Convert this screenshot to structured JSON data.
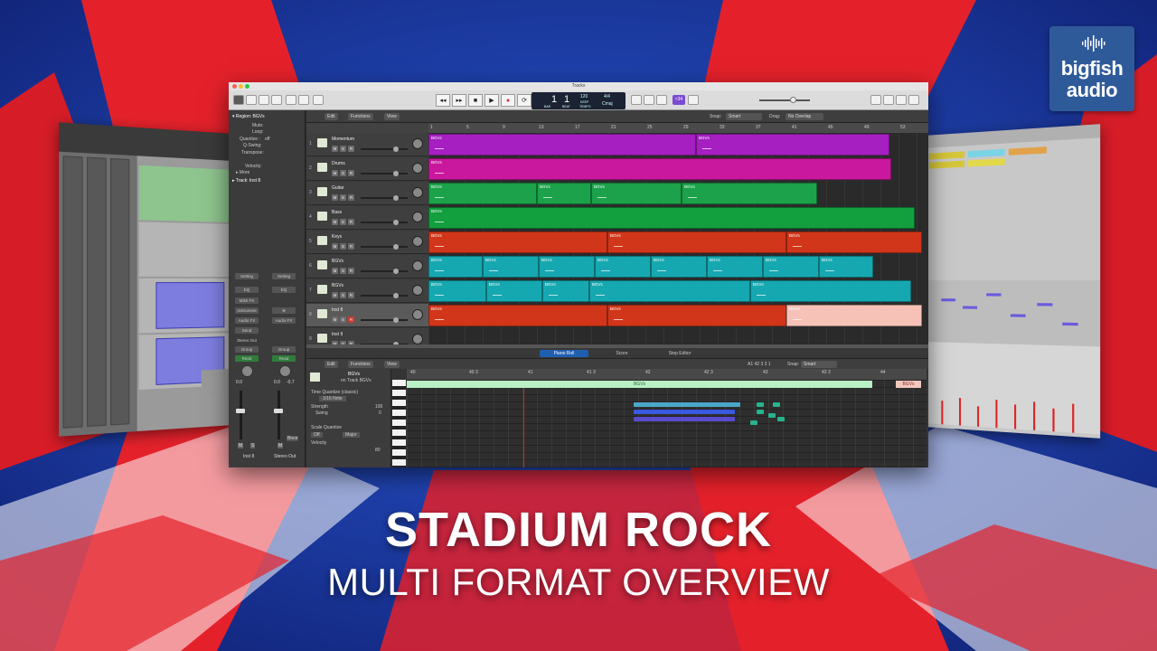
{
  "brand": {
    "line1": "bigfish",
    "line2": "audio"
  },
  "headline": {
    "title": "STADIUM ROCK",
    "subtitle": "MULTI FORMAT OVERVIEW"
  },
  "colors": {
    "bg_red": "#e4212b",
    "bg_blue": "#1e3aa8",
    "logo": "#2f5a9a",
    "accent_purple": "#7a4bd1"
  },
  "logic": {
    "window_title": "Tracks",
    "lcd": {
      "bar": "1",
      "beat": "1",
      "bar_label": "BAR",
      "beat_label": "BEAT",
      "tempo": "120",
      "tempo_label": "KEEP",
      "tempo_sub": "TEMPO",
      "sig": "4/4",
      "key": "Cmaj"
    },
    "cpu_badge": "≈34",
    "inspector": {
      "region_label": "▾ Region: BGVs",
      "mute": "Mute:",
      "loop": "Loop:",
      "quantize": "Quantize :",
      "quantize_val": "off",
      "qswing": "Q-Swing:",
      "transpose": "Transpose:",
      "velocity": "Velocity:",
      "more": "▸ More",
      "track_label": "▸ Track: Inst 8",
      "setting": "Setting",
      "eq": "EQ",
      "midi_fx": "MIDI FX",
      "instrument": "Instrument",
      "audio_fx": "Audio FX",
      "send": "Send",
      "stereo_out": "Stereo Out",
      "group": "Group",
      "read": "Read",
      "vol_left": "0.0",
      "vol_right": "0.0",
      "vol_right2": "-0.7",
      "ch_left": "Inst 8",
      "ch_right": "Stereo Out",
      "bnce": "Bnce",
      "m": "M",
      "s": "S"
    },
    "toolbar": {
      "edit": "Edit",
      "functions": "Functions",
      "view": "View",
      "snap_label": "Snap:",
      "snap": "Smart",
      "drag_label": "Drag:",
      "drag": "No Overlap"
    },
    "ruler": [
      "1",
      "5",
      "9",
      "13",
      "17",
      "21",
      "25",
      "29",
      "33",
      "37",
      "41",
      "45",
      "49",
      "53"
    ],
    "tracks": [
      {
        "num": "1",
        "name": "Momentum",
        "color": "#a51fc1"
      },
      {
        "num": "2",
        "name": "Drums",
        "color": "#c9179e"
      },
      {
        "num": "3",
        "name": "Guitar",
        "color": "#1ba24a"
      },
      {
        "num": "4",
        "name": "Bass",
        "color": "#129f3e"
      },
      {
        "num": "5",
        "name": "Keys",
        "color": "#d1361a"
      },
      {
        "num": "6",
        "name": "BGVs",
        "color": "#16a8b0"
      },
      {
        "num": "7",
        "name": "BGVs",
        "color": "#16a8b0"
      },
      {
        "num": "8",
        "name": "Inst 8",
        "color": "#d1361a"
      },
      {
        "num": "9",
        "name": "Inst 9",
        "color": "#3f3f3f"
      }
    ],
    "region_name": "BGVs",
    "editor_tabs": {
      "piano_roll": "Piano Roll",
      "score": "Score",
      "step_editor": "Step Editor"
    },
    "piano_roll": {
      "region": "BGVs",
      "on_track": "on Track BGVs",
      "time_quantize": "Time Quantize (classic)",
      "note_val": "1/16 Note",
      "strength": "Strength",
      "strength_val": "100",
      "swing": "Swing",
      "swing_val": "0",
      "scale_quantize": "Scale Quantize",
      "scale_off": "Off",
      "scale_major": "Major",
      "velocity": "Velocity",
      "velocity_val": "80",
      "position": "A1  42 3 3 1",
      "snap": "Smart",
      "ruler": [
        "40",
        "40 3",
        "41",
        "41 3",
        "42",
        "42 3",
        "43",
        "43 3",
        "44"
      ]
    }
  }
}
